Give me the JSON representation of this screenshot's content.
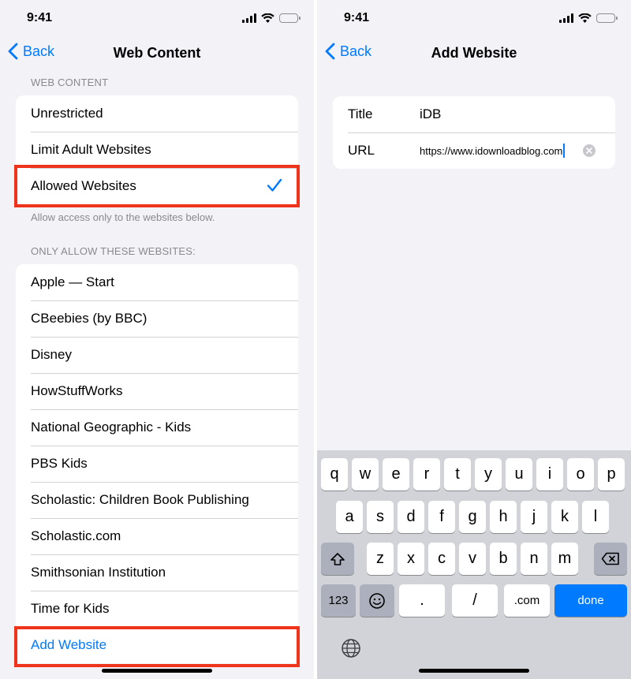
{
  "left": {
    "status_time": "9:41",
    "nav": {
      "back_label": "Back",
      "title": "Web Content"
    },
    "web_content_header": "WEB CONTENT",
    "options": [
      {
        "label": "Unrestricted"
      },
      {
        "label": "Limit Adult Websites"
      },
      {
        "label": "Allowed Websites",
        "selected": true
      }
    ],
    "options_footer": "Allow access only to the websites below.",
    "allowed_header": "ONLY ALLOW THESE WEBSITES:",
    "websites": [
      "Apple — Start",
      "CBeebies (by BBC)",
      "Disney",
      "HowStuffWorks",
      "National Geographic - Kids",
      "PBS Kids",
      "Scholastic: Children Book Publishing",
      "Scholastic.com",
      "Smithsonian Institution",
      "Time for Kids"
    ],
    "add_website_label": "Add Website"
  },
  "right": {
    "status_time": "9:41",
    "nav": {
      "back_label": "Back",
      "title": "Add Website"
    },
    "form": {
      "title_label": "Title",
      "title_value": "iDB",
      "url_label": "URL",
      "url_value": "https://www.idownloadblog.com"
    },
    "keyboard": {
      "row1": [
        "q",
        "w",
        "e",
        "r",
        "t",
        "y",
        "u",
        "i",
        "o",
        "p"
      ],
      "row2": [
        "a",
        "s",
        "d",
        "f",
        "g",
        "h",
        "j",
        "k",
        "l"
      ],
      "row3": [
        "z",
        "x",
        "c",
        "v",
        "b",
        "n",
        "m"
      ],
      "numbers_key": "123",
      "dot_key": ".",
      "slash_key": "/",
      "dotcom_key": ".com",
      "done_key": "done"
    }
  },
  "colors": {
    "accent": "#007aff",
    "highlight": "#f0341c",
    "background": "#f2f2f7",
    "keyboard": "#d1d3d9"
  }
}
